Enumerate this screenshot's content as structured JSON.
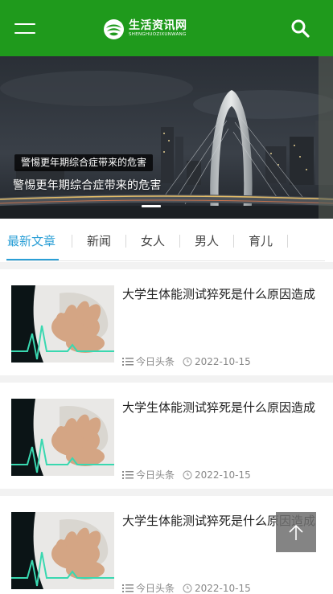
{
  "header": {
    "brand_name": "生活资讯网",
    "brand_sub": "SHENGHUOZIXUNWANG",
    "bg_color": "#1f9a1c"
  },
  "banner": {
    "tag": "警惕更年期综合症带来的危害",
    "caption": "警惕更年期综合症带来的危害"
  },
  "tabs": [
    "最新文章",
    "新闻",
    "女人",
    "男人",
    "育儿"
  ],
  "active_tab": "最新文章",
  "accent_color": "#2b9fd6",
  "articles": [
    {
      "title": "大学生体能测试猝死是什么原因造成",
      "source": "今日头条",
      "date": "2022-10-15"
    },
    {
      "title": "大学生体能测试猝死是什么原因造成",
      "source": "今日头条",
      "date": "2022-10-15"
    },
    {
      "title": "大学生体能测试猝死是什么原因造成",
      "source": "今日头条",
      "date": "2022-10-15"
    }
  ],
  "icons": [
    "menu-icon",
    "logo-icon",
    "search-icon",
    "list-icon",
    "clock-icon",
    "arrow-up-icon"
  ]
}
